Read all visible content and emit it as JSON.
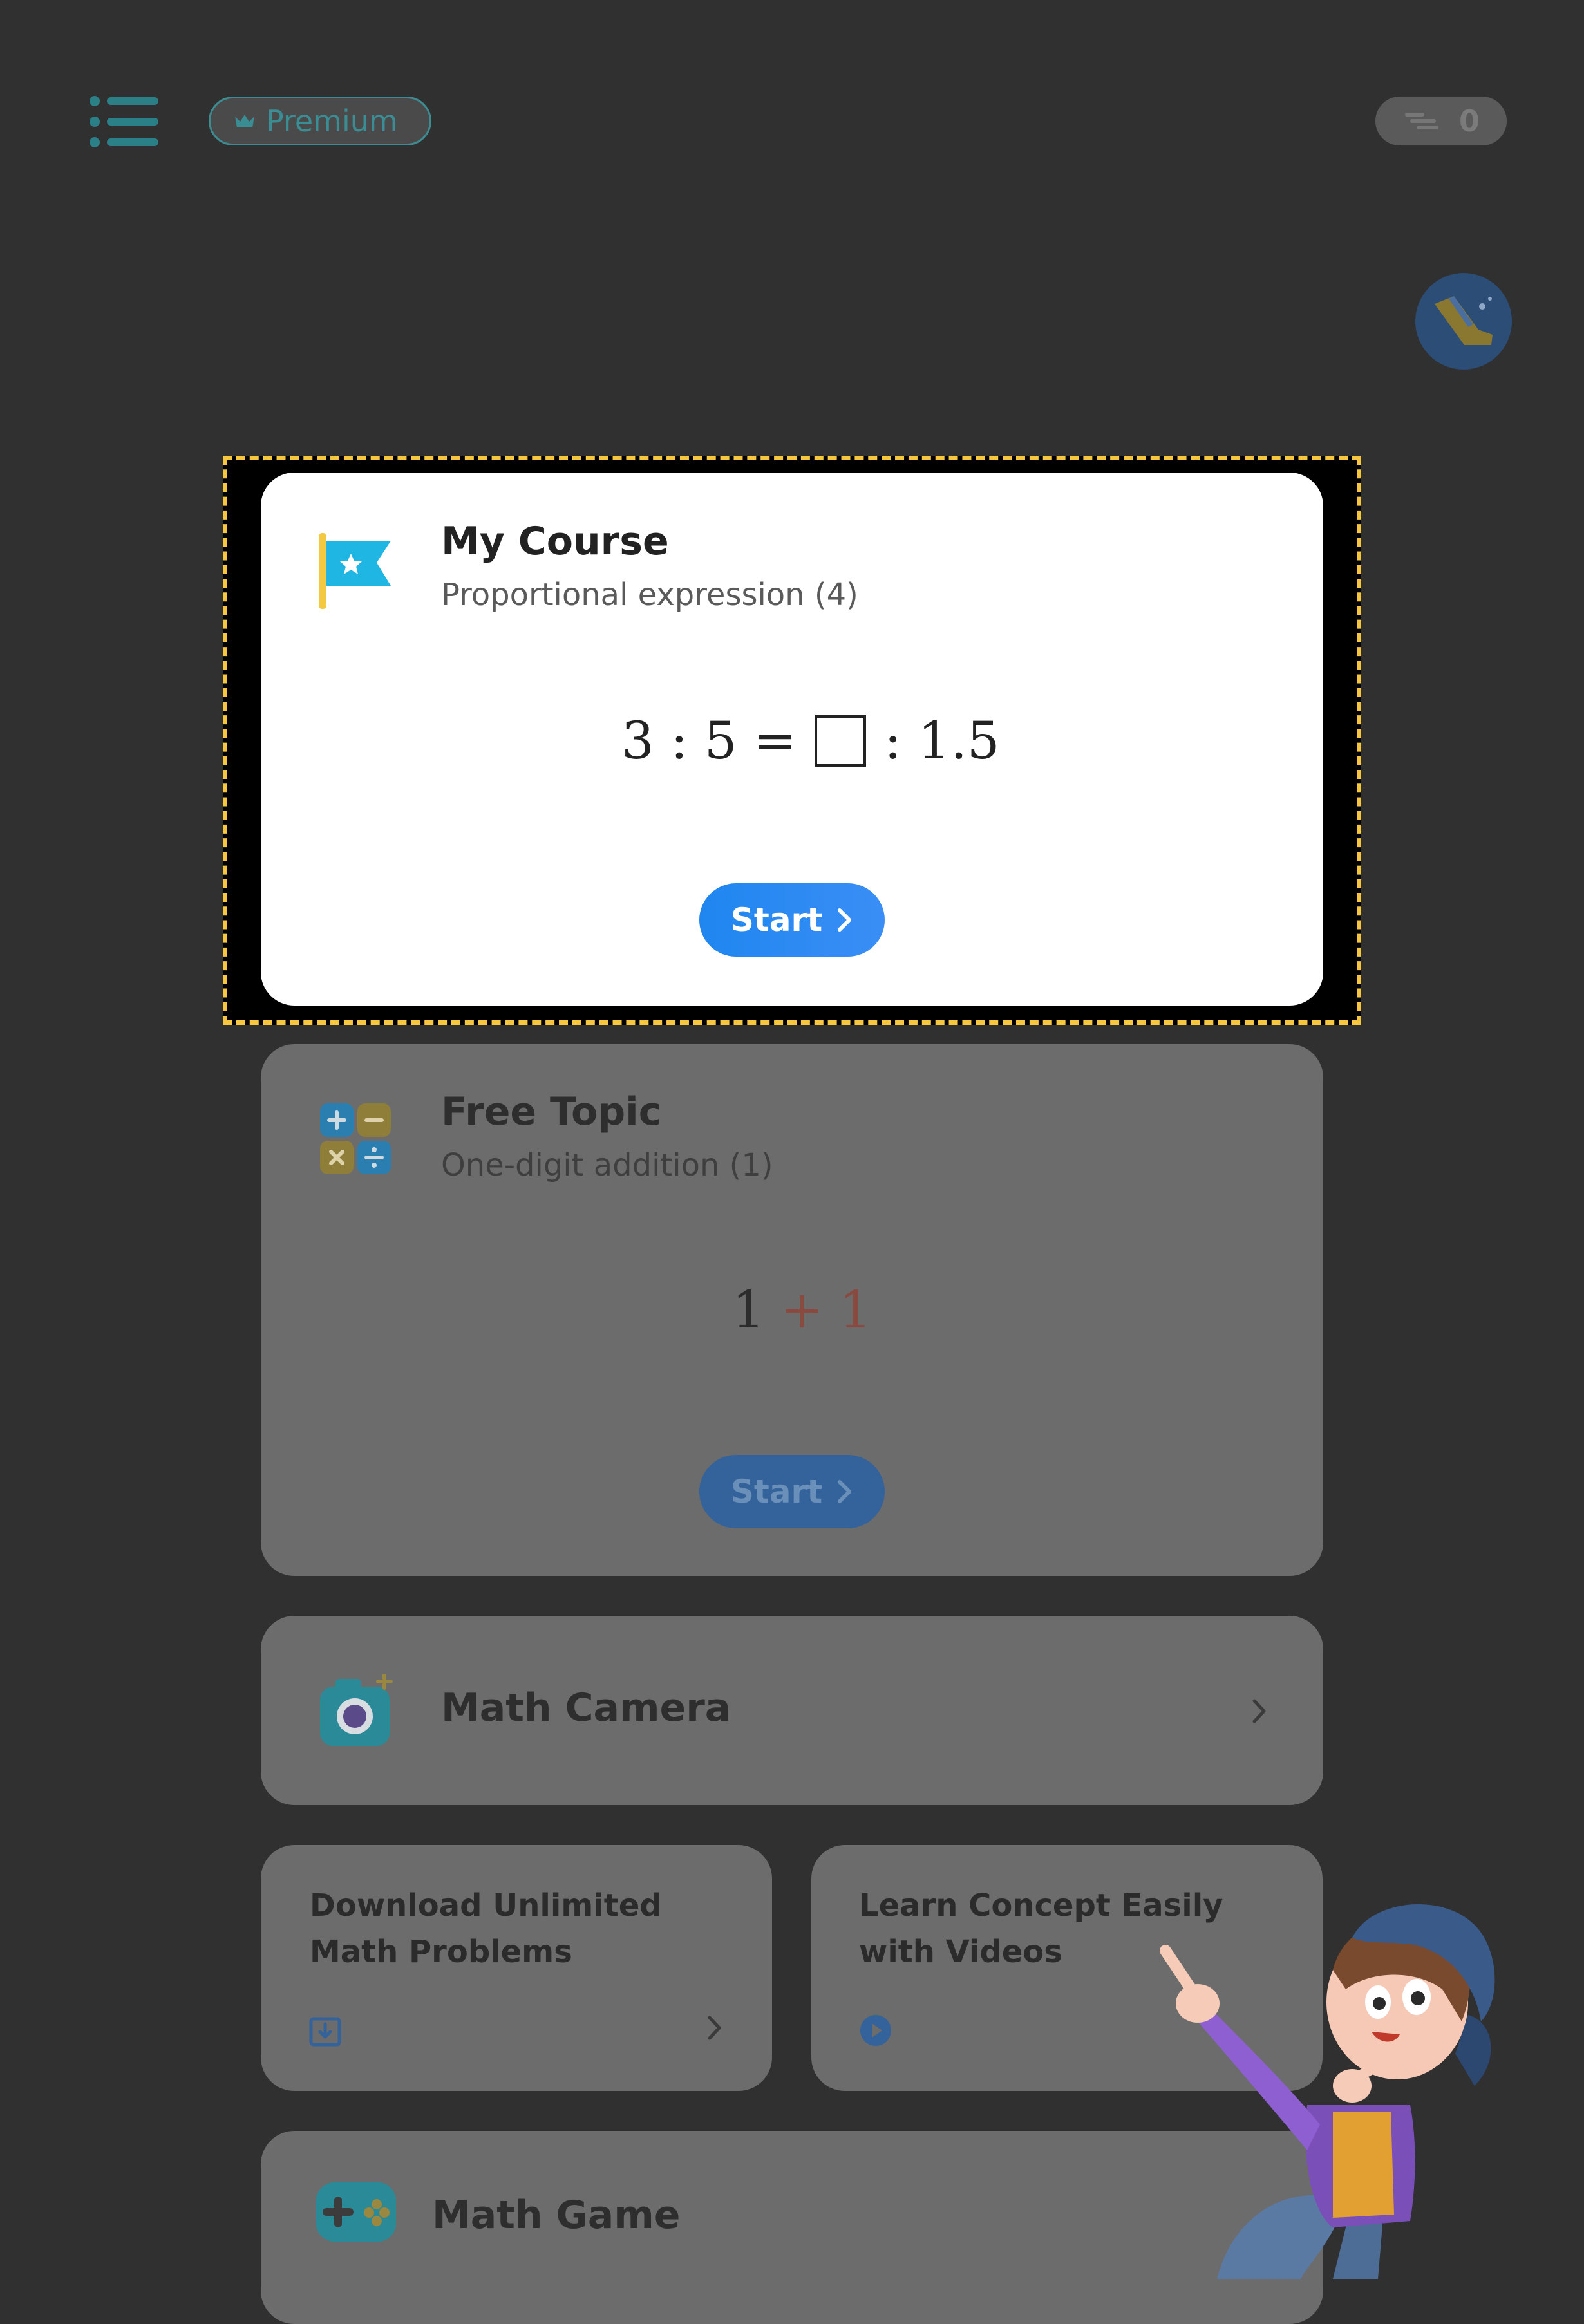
{
  "header": {
    "premium_label": "Premium",
    "coins": "0"
  },
  "my_course": {
    "title": "My Course",
    "subtitle": "Proportional expression (4)",
    "expression_left": "3 : 5 =",
    "expression_right": ": 1.5",
    "start_label": "Start"
  },
  "free_topic": {
    "title": "Free Topic",
    "subtitle": "One-digit addition (1)",
    "expr_a": "1",
    "expr_op": "+",
    "expr_b": "1",
    "start_label": "Start"
  },
  "math_camera": {
    "title": "Math Camera"
  },
  "download_card": {
    "title": "Download Unlimited Math Problems"
  },
  "videos_card": {
    "title": "Learn Concept Easily with Videos"
  },
  "math_game": {
    "title": "Math Game"
  },
  "colors": {
    "background": "#303030",
    "accent_blue": "#1f86f0",
    "teal": "#3a8d93",
    "highlight": "#f6c63f"
  }
}
